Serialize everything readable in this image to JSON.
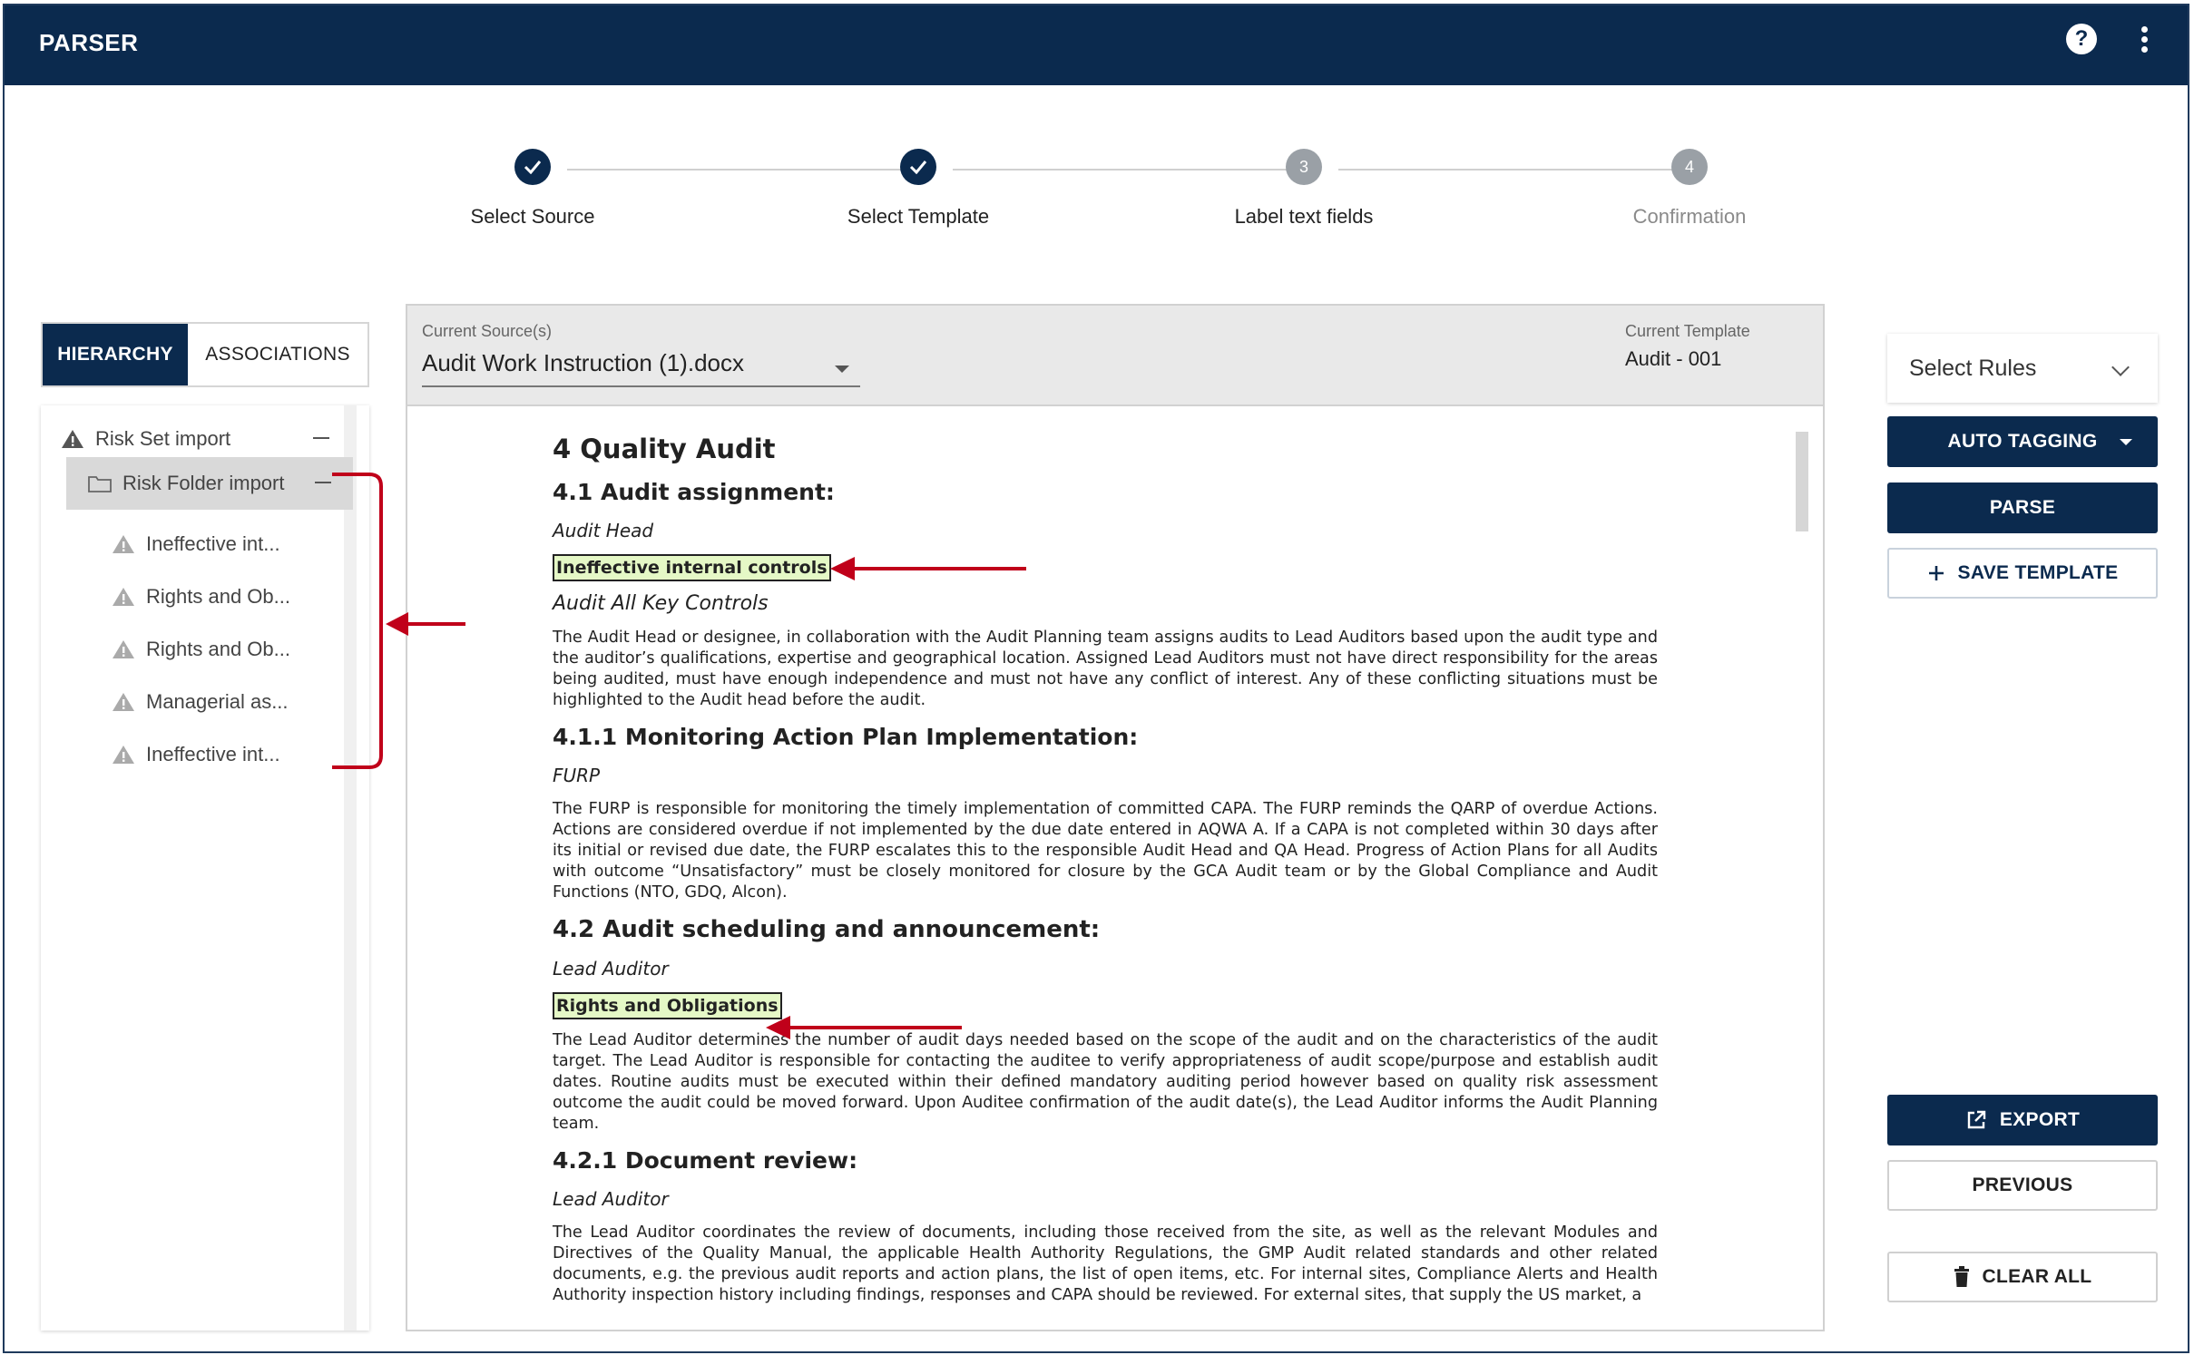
{
  "app": {
    "title": "PARSER"
  },
  "stepper": {
    "steps": [
      {
        "label": "Select Source",
        "state": "done"
      },
      {
        "label": "Select Template",
        "state": "done"
      },
      {
        "label": "Label text fields",
        "number": "3",
        "state": "current"
      },
      {
        "label": "Confirmation",
        "number": "4",
        "state": "upcoming"
      }
    ]
  },
  "left_panel": {
    "tabs": [
      "HIERARCHY",
      "ASSOCIATIONS"
    ],
    "active_tab": "HIERARCHY",
    "tree": {
      "root": "Risk Set import",
      "folder": "Risk Folder import",
      "children": [
        "Ineffective int...",
        "Rights and Ob...",
        "Rights and Ob...",
        "Managerial as...",
        "Ineffective int..."
      ]
    }
  },
  "source_bar": {
    "source_caption": "Current Source(s)",
    "source_value": "Audit Work Instruction (1).docx",
    "template_caption": "Current Template",
    "template_value": "Audit - 001"
  },
  "document": {
    "h_4": "4 Quality Audit",
    "h_4_1": "4.1 Audit assignment:",
    "role_1": "Audit Head",
    "tag_1": "Ineffective internal controls",
    "role_2": "Audit All Key Controls",
    "para_1": "The Audit Head or designee, in collaboration with the Audit Planning team assigns audits to Lead Auditors based upon the audit type and the auditor’s qualifications, expertise and geographical location. Assigned Lead Auditors must not have direct responsibility for the areas being audited, must have enough independence and must not have any conflict of interest. Any of these conflicting situations must be highlighted to the Audit head before the audit.",
    "h_4_1_1": "4.1.1 Monitoring Action Plan Implementation:",
    "role_3": "FURP",
    "para_2": "The FURP is responsible for monitoring the timely implementation of committed CAPA. The FURP reminds the QARP of overdue Actions. Actions are considered overdue if not implemented by the due date entered in AQWA A. If a CAPA is not completed within 30 days after its initial or revised due date, the FURP escalates this to the responsible Audit Head and QA Head. Progress of Action Plans for all Audits with outcome “Unsatisfactory” must be closely monitored for closure by the GCA Audit team or by the Global Compliance and Audit Functions (NTO, GDQ, Alcon).",
    "h_4_2": "4.2 Audit scheduling and announcement:",
    "role_4": "Lead Auditor",
    "tag_2": "Rights and Obligations",
    "para_3": "The Lead Auditor determines the number of audit days needed based on the scope of the audit and on the characteristics of the audit target. The Lead Auditor is responsible for contacting the auditee to verify appropriateness of audit scope/purpose and establish audit dates. Routine audits must be executed within their defined mandatory auditing period however based on quality risk assessment outcome the audit could be moved forward. Upon Auditee confirmation of the audit date(s), the Lead Auditor informs the Audit Planning team.",
    "h_4_2_1": "4.2.1 Document review:",
    "role_5": "Lead Auditor",
    "para_4": "The Lead Auditor coordinates the review of documents, including those received from the site, as well as the relevant Modules and Directives of the  Quality Manual, the applicable Health Authority Regulations, the GMP Audit related standards and other related documents, e.g. the previous audit reports and action plans, the list of open items, etc. For internal sites, Compliance Alerts and Health Authority inspection history including findings, responses and CAPA should be reviewed. For external sites, that supply the US market, a"
  },
  "right_panel": {
    "select_rules": "Select Rules",
    "auto_tagging": "AUTO TAGGING",
    "parse": "PARSE",
    "save_template": "SAVE TEMPLATE",
    "export": "EXPORT",
    "previous": "PREVIOUS",
    "clear_all": "CLEAR ALL"
  },
  "colors": {
    "primary": "#0b2a4e",
    "highlight": "#e5f8c6",
    "annotation": "#c0001a"
  }
}
